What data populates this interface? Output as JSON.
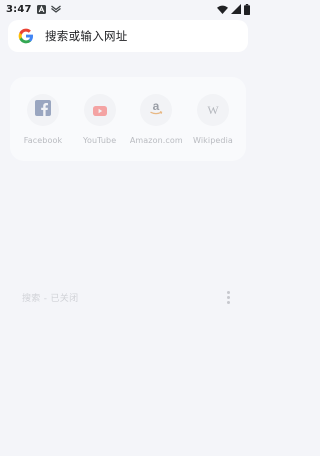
{
  "status_bar": {
    "time": "3:47",
    "icons": [
      "notification-a-icon",
      "notification-mail-icon",
      "wifi-icon",
      "signal-icon",
      "battery-icon"
    ]
  },
  "search": {
    "placeholder": "搜索或输入网址",
    "icon": "google-g-icon"
  },
  "shortcuts": [
    {
      "label": "Facebook",
      "icon": "facebook-icon"
    },
    {
      "label": "YouTube",
      "icon": "youtube-icon"
    },
    {
      "label": "Amazon.com",
      "icon": "amazon-icon"
    },
    {
      "label": "Wikipedia",
      "icon": "wikipedia-icon"
    }
  ],
  "history": {
    "label": "搜索 - 已关闭",
    "menu_icon": "more-vert-icon"
  },
  "colors": {
    "background": "#f4f5f9",
    "card": "#f9fafc",
    "search_bg": "#ffffff",
    "facebook": "#3b5998",
    "youtube": "#ff0000",
    "amazon": "#232f3e"
  }
}
